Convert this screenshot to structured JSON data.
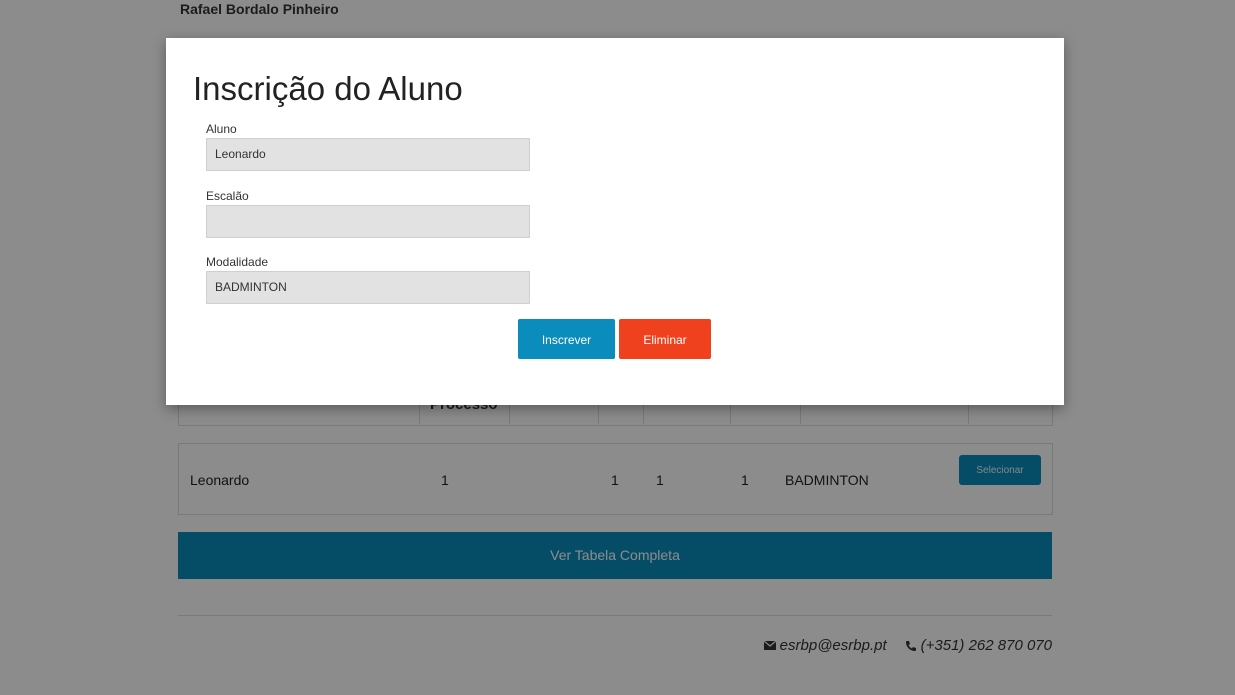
{
  "page": {
    "school_name": "Rafael Bordalo Pinheiro",
    "table_header_processo": "Processo",
    "row": {
      "aluno": "Leonardo",
      "processo": "1",
      "c3": "1",
      "c4": "1",
      "c5": "1",
      "modalidade": "BADMINTON",
      "select_label": "Selecionar"
    },
    "full_table_label": "Ver Tabela Completa",
    "footer": {
      "email": "esrbp@esrbp.pt",
      "phone": "(+351) 262 870 070"
    }
  },
  "modal": {
    "title": "Inscrição do Aluno",
    "fields": {
      "aluno": {
        "label": "Aluno",
        "value": "Leonardo"
      },
      "escalao": {
        "label": "Escalão",
        "value": ""
      },
      "modalidade": {
        "label": "Modalidade",
        "value": "BADMINTON"
      }
    },
    "buttons": {
      "inscrever": "Inscrever",
      "eliminar": "Eliminar"
    }
  },
  "colors": {
    "primary": "#0a8cbc",
    "danger": "#f0411e",
    "overlay": "rgba(0,0,0,0.45)"
  }
}
